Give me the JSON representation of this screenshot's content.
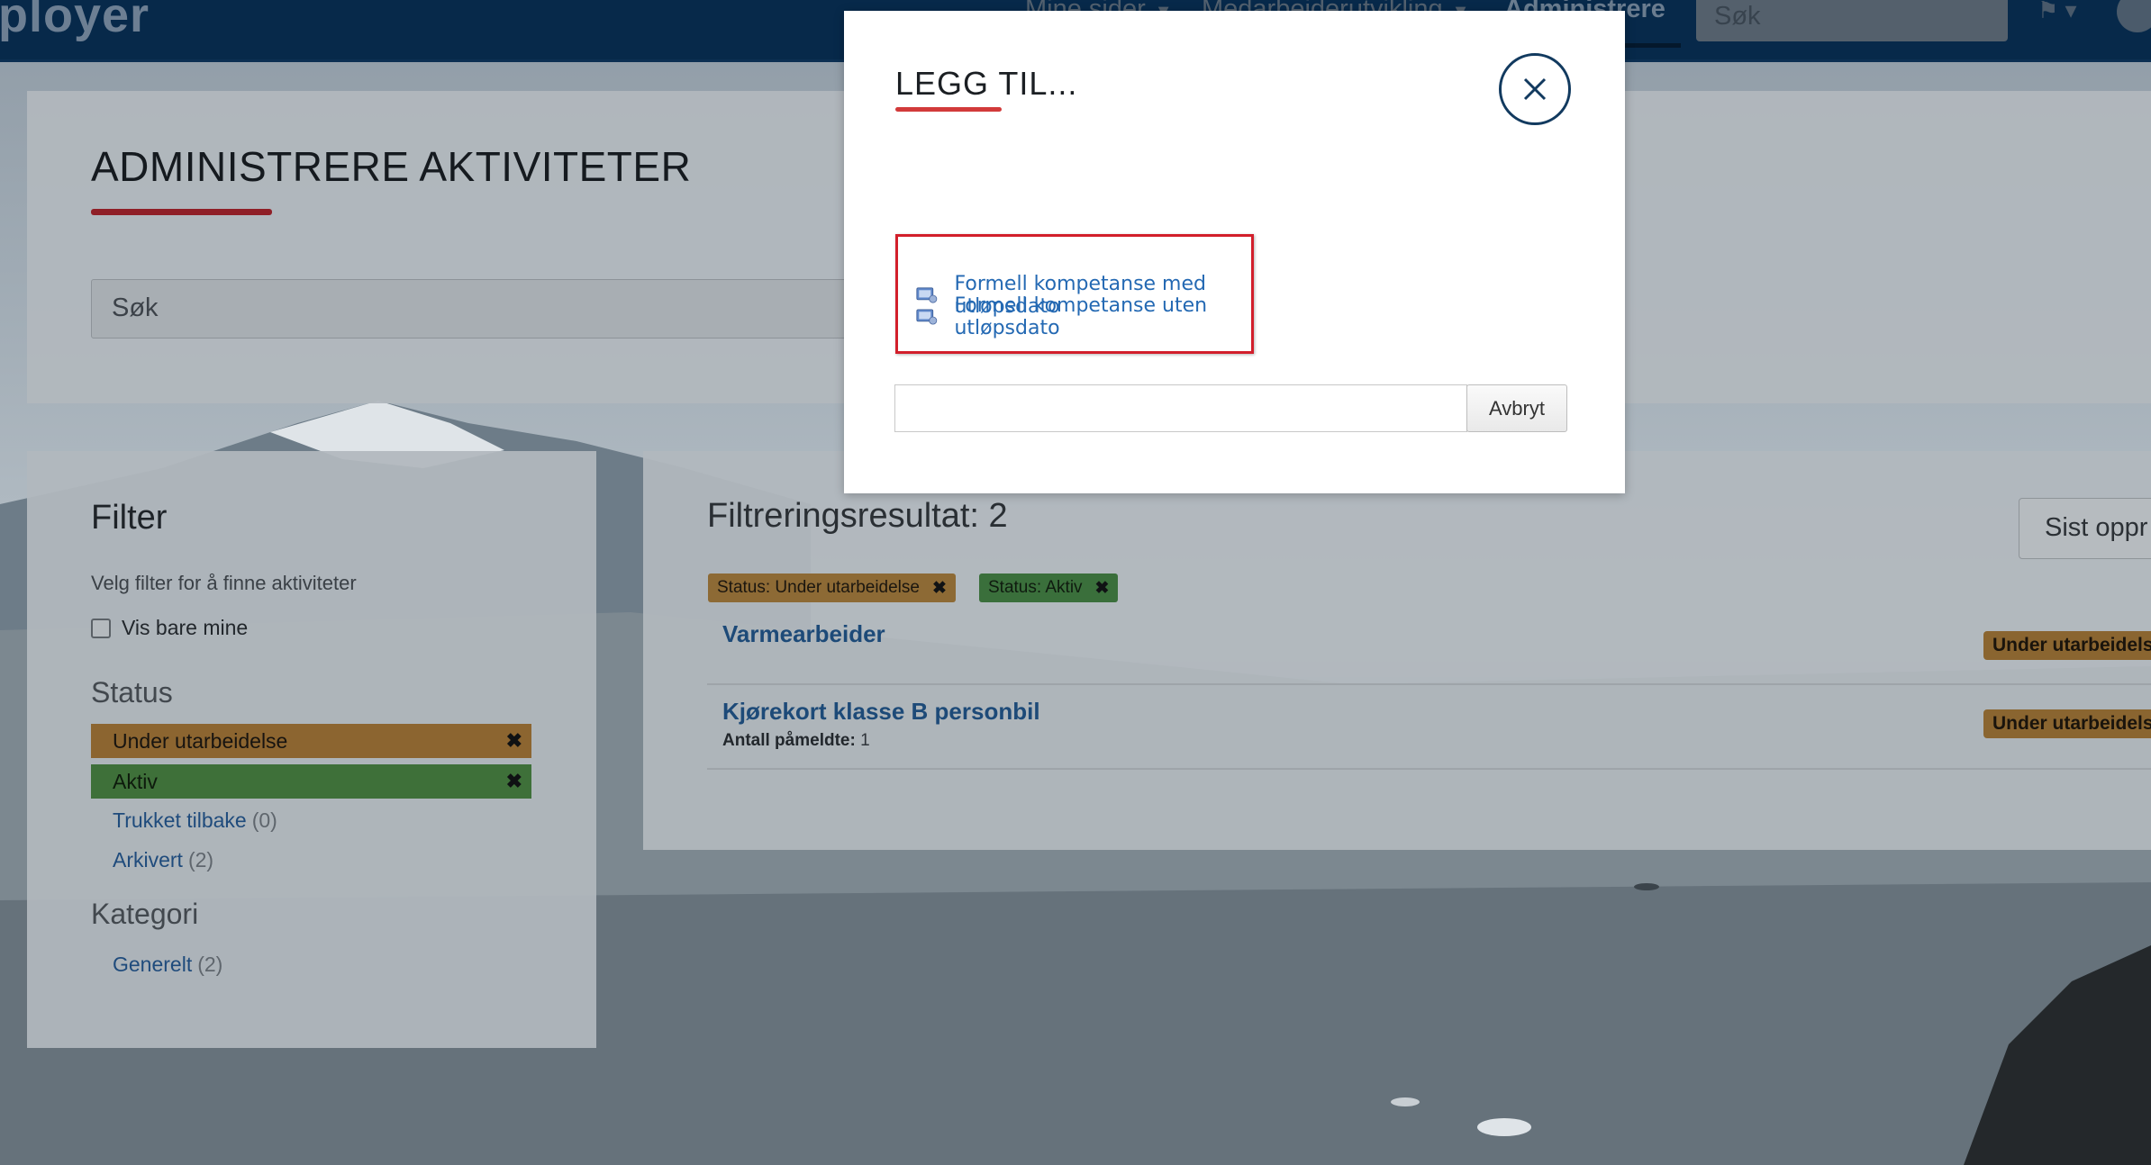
{
  "navbar": {
    "logo": "ployer",
    "items": [
      {
        "label": "Mine sider",
        "has_caret": true
      },
      {
        "label": "Medarbeiderutvikling",
        "has_caret": true
      },
      {
        "label": "Administrere",
        "has_caret": false,
        "active": true
      }
    ],
    "search_placeholder": "Søk",
    "flag_icon": "flag-icon",
    "user_icon": "user-icon"
  },
  "page": {
    "title": "ADMINISTRERE AKTIVITETER",
    "search_placeholder": "Søk"
  },
  "filter": {
    "title": "Filter",
    "help": "Velg filter for å finne aktiviteter",
    "only_mine_label": "Vis bare mine",
    "status_title": "Status",
    "active_statuses": [
      {
        "label": "Under utarbeidelse",
        "color": "#f0ad4e"
      },
      {
        "label": "Aktiv",
        "color": "#5cb85c"
      }
    ],
    "other_statuses": [
      {
        "label": "Trukket tilbake",
        "count": "(0)"
      },
      {
        "label": "Arkivert",
        "count": "(2)"
      }
    ],
    "category_title": "Kategori",
    "categories": [
      {
        "label": "Generelt",
        "count": "(2)"
      }
    ]
  },
  "results": {
    "title": "Filtreringsresultat: 2",
    "tags": [
      {
        "label": "Status: Under utarbeidelse"
      },
      {
        "label": "Status: Aktiv"
      }
    ],
    "sort_label": "Sist oppr",
    "items": [
      {
        "title": "Varmearbeider",
        "badge": "Under utarbeidelse"
      },
      {
        "title": "Kjørekort klasse B personbil",
        "meta_label": "Antall påmeldte:",
        "meta_value": "1",
        "badge": "Under utarbeidelse"
      }
    ]
  },
  "modal": {
    "title": "LEGG TIL...",
    "options": [
      {
        "label": "Formell kompetanse med utløpsdato",
        "icon": "certificate-icon"
      },
      {
        "label": "Formell kompetanse uten utløpsdato",
        "icon": "certificate-icon"
      }
    ],
    "input_value": "",
    "cancel_label": "Avbryt"
  },
  "colors": {
    "navbar": "#07294a",
    "accent_red": "#d23a3a",
    "link_blue": "#2469b3",
    "highlight_red": "#d21f2b"
  }
}
